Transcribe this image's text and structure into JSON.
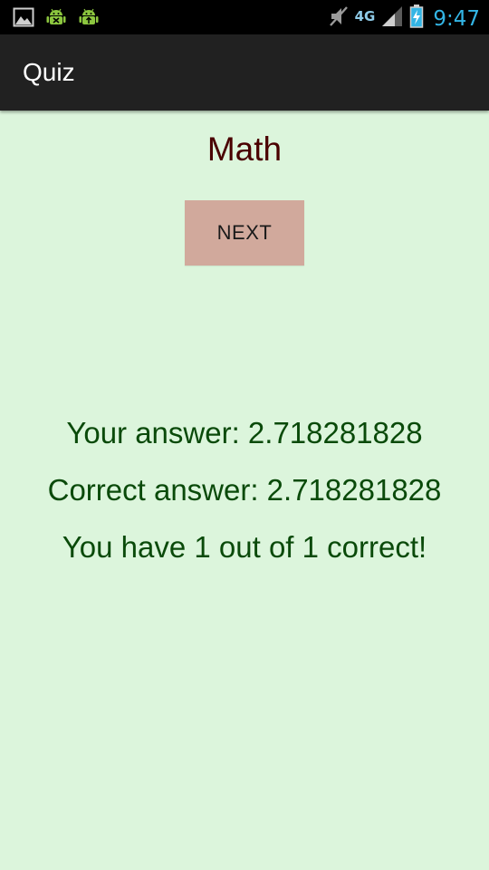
{
  "status_bar": {
    "time": "9:47",
    "network_type": "4G",
    "icons": [
      "image-icon",
      "android-debug-icon",
      "android-usb-icon",
      "mute-icon",
      "signal-icon",
      "battery-icon"
    ]
  },
  "action_bar": {
    "title": "Quiz"
  },
  "quiz": {
    "subject": "Math",
    "next_label": "NEXT",
    "your_answer": "Your answer: 2.718281828",
    "correct_answer": "Correct answer: 2.718281828",
    "score": "You have 1 out of 1 correct!"
  },
  "colors": {
    "background": "#dcf5dc",
    "action_bar": "#212121",
    "button": "#d1a99c",
    "subject_text": "#4a0000",
    "result_text": "#0a4a0a",
    "status_time": "#33b5e5"
  }
}
